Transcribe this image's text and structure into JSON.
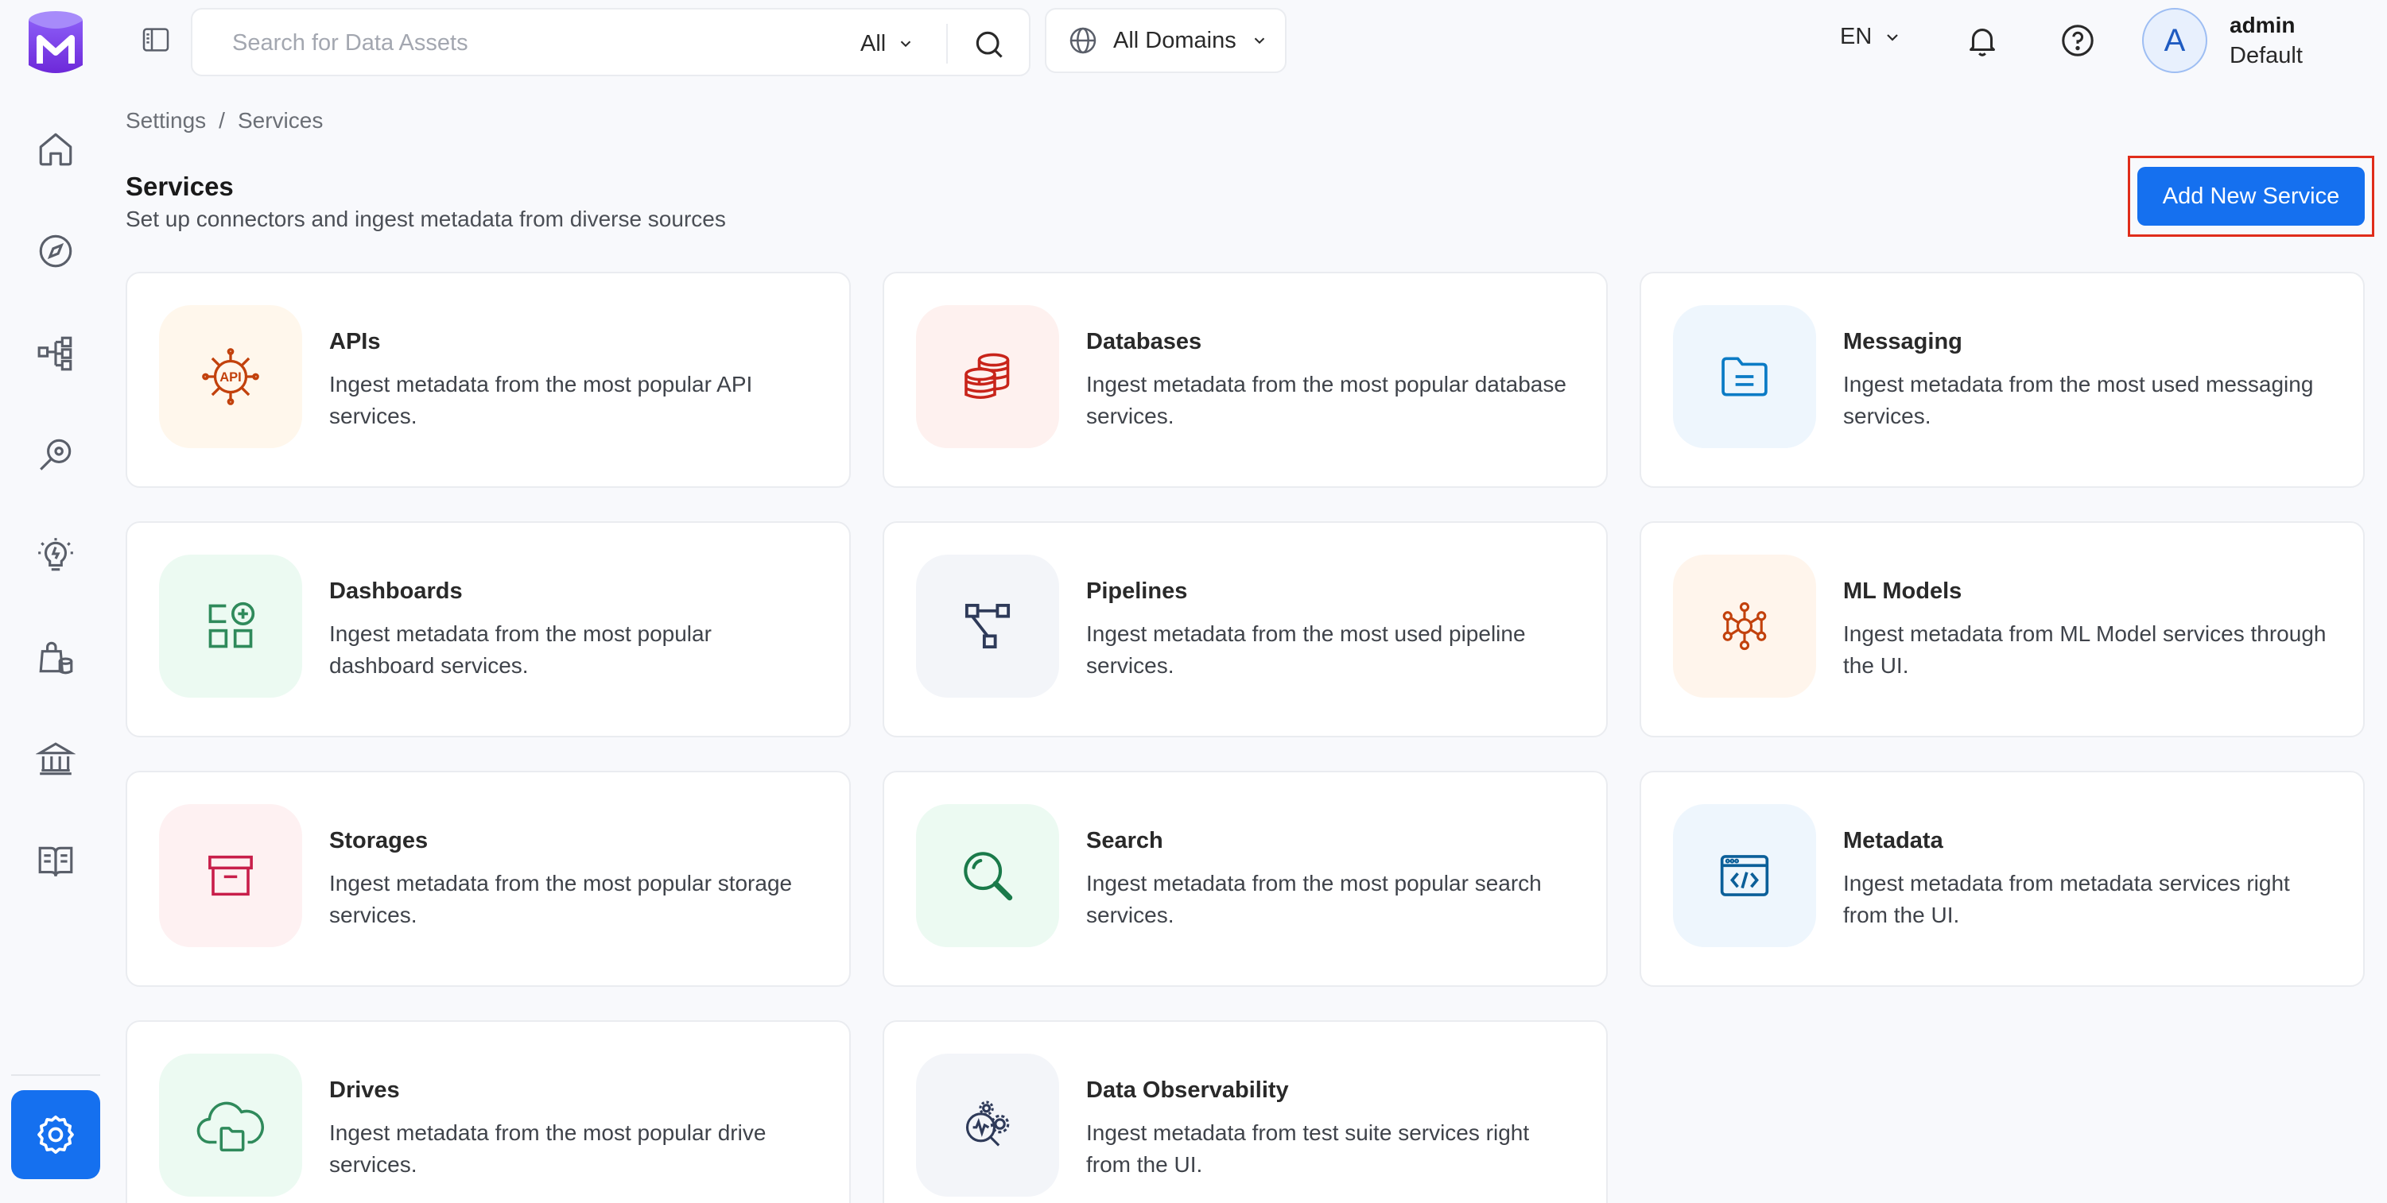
{
  "search": {
    "placeholder": "Search for Data Assets",
    "filter_label": "All"
  },
  "domain_selector": {
    "label": "All Domains"
  },
  "language": {
    "label": "EN"
  },
  "user": {
    "avatar_letter": "A",
    "name": "admin",
    "role": "Default"
  },
  "breadcrumb": {
    "items": [
      "Settings",
      "/",
      "Services"
    ]
  },
  "page": {
    "title": "Services",
    "subtitle": "Set up connectors and ingest metadata from diverse sources",
    "add_button_label": "Add New Service"
  },
  "colors": {
    "accent": "#1570ef",
    "highlight_border": "#e02d1b"
  },
  "services": [
    {
      "title": "APIs",
      "description": "Ingest metadata from the most popular API services.",
      "icon": "api-chip-icon",
      "tile_color": "#fff7ec",
      "icon_color": "#c2410c"
    },
    {
      "title": "Databases",
      "description": "Ingest metadata from the most popular database services.",
      "icon": "database-icon",
      "tile_color": "#fef1ef",
      "icon_color": "#c8241a"
    },
    {
      "title": "Messaging",
      "description": "Ingest metadata from the most used messaging services.",
      "icon": "messaging-folder-icon",
      "tile_color": "#eef6fd",
      "icon_color": "#0b7bc5"
    },
    {
      "title": "Dashboards",
      "description": "Ingest metadata from the most popular dashboard services.",
      "icon": "dashboard-icon",
      "tile_color": "#ecfaf2",
      "icon_color": "#2f8a5b"
    },
    {
      "title": "Pipelines",
      "description": "Ingest metadata from the most used pipeline services.",
      "icon": "pipeline-icon",
      "tile_color": "#f3f5f9",
      "icon_color": "#2e3a59"
    },
    {
      "title": "ML Models",
      "description": "Ingest metadata from ML Model services through the UI.",
      "icon": "ml-model-icon",
      "tile_color": "#fff5ec",
      "icon_color": "#c2410c"
    },
    {
      "title": "Storages",
      "description": "Ingest metadata from the most popular storage services.",
      "icon": "storage-archive-icon",
      "tile_color": "#fef1f2",
      "icon_color": "#c81e4a"
    },
    {
      "title": "Search",
      "description": "Ingest metadata from the most popular search services.",
      "icon": "search-magnifier-icon",
      "tile_color": "#ecfaf2",
      "icon_color": "#1a7a4a"
    },
    {
      "title": "Metadata",
      "description": "Ingest metadata from metadata services right from the UI.",
      "icon": "metadata-code-icon",
      "tile_color": "#eef6fd",
      "icon_color": "#0b5f99"
    },
    {
      "title": "Drives",
      "description": "Ingest metadata from the most popular drive services.",
      "icon": "drive-cloud-icon",
      "tile_color": "#ecfaf2",
      "icon_color": "#2f8a5b"
    },
    {
      "title": "Data Observability",
      "description": "Ingest metadata from test suite services right from the UI.",
      "icon": "data-observability-icon",
      "tile_color": "#f3f5f9",
      "icon_color": "#2e3a59"
    }
  ]
}
